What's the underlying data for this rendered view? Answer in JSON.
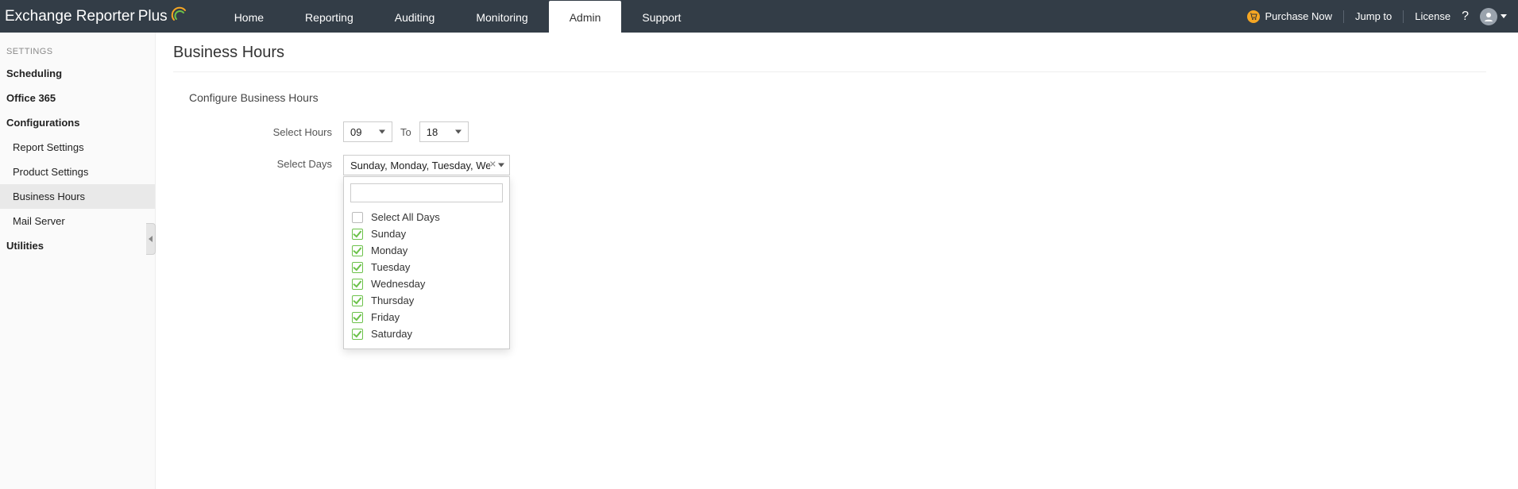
{
  "brand": {
    "name_a": "Exchange Reporter",
    "name_b": "Plus"
  },
  "nav": {
    "home": "Home",
    "reporting": "Reporting",
    "auditing": "Auditing",
    "monitoring": "Monitoring",
    "admin": "Admin",
    "support": "Support"
  },
  "header_right": {
    "purchase": "Purchase Now",
    "jump_to": "Jump to",
    "license": "License"
  },
  "sidebar": {
    "heading": "SETTINGS",
    "scheduling": "Scheduling",
    "office365": "Office 365",
    "configurations": "Configurations",
    "report_settings": "Report Settings",
    "product_settings": "Product Settings",
    "business_hours": "Business Hours",
    "mail_server": "Mail Server",
    "utilities": "Utilities"
  },
  "page": {
    "title": "Business Hours",
    "section": "Configure Business Hours",
    "select_hours_label": "Select Hours",
    "to_label": "To",
    "hour_from": "09",
    "hour_to": "18",
    "select_days_label": "Select Days",
    "days_display": "Sunday, Monday, Tuesday, Wednesday, Thursday, Friday, Saturday",
    "dropdown_search_placeholder": "",
    "select_all_label": "Select All Days",
    "days": [
      {
        "label": "Sunday",
        "checked": true
      },
      {
        "label": "Monday",
        "checked": true
      },
      {
        "label": "Tuesday",
        "checked": true
      },
      {
        "label": "Wednesday",
        "checked": true
      },
      {
        "label": "Thursday",
        "checked": true
      },
      {
        "label": "Friday",
        "checked": true
      },
      {
        "label": "Saturday",
        "checked": true
      }
    ]
  }
}
